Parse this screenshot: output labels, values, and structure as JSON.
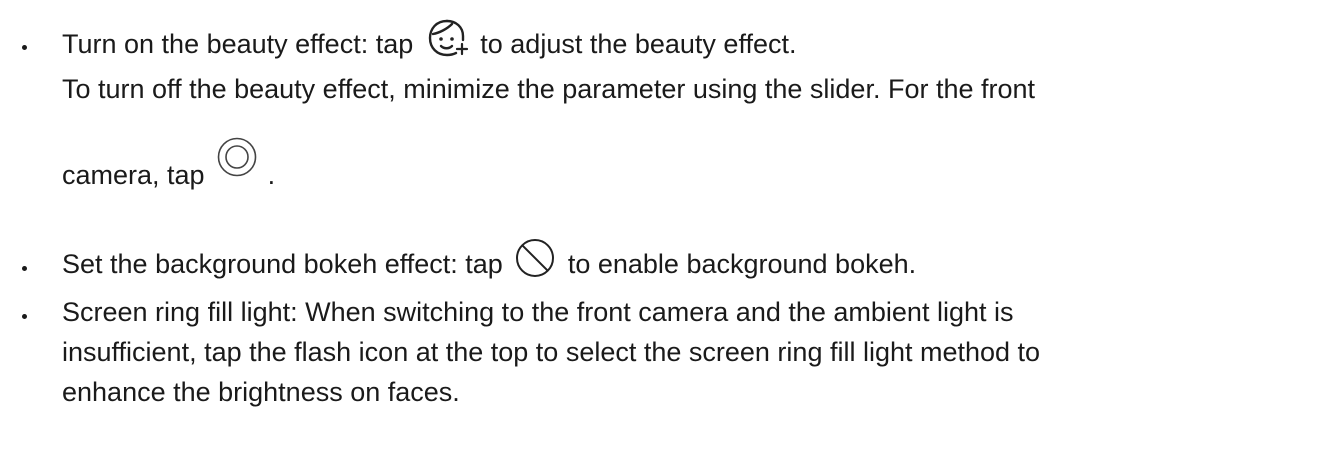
{
  "items": [
    {
      "lines": [
        {
          "before": "Turn on the beauty effect: tap ",
          "icon": "beauty-face-icon",
          "after": " to adjust the beauty effect."
        },
        {
          "text": "To turn off the beauty effect, minimize the parameter using the slider. For the front"
        },
        {
          "before": "camera, tap ",
          "icon": "circle-shutter-icon",
          "after": "."
        }
      ]
    },
    {
      "lines": [
        {
          "before": "Set the background bokeh effect: tap ",
          "icon": "bokeh-off-icon",
          "after": " to enable background bokeh."
        }
      ]
    },
    {
      "lines": [
        {
          "text": "Screen ring fill light: When switching to the front camera and the ambient light is"
        },
        {
          "text": "insufficient, tap the flash icon at the top to select the screen ring fill light method to"
        },
        {
          "text": "enhance the brightness on faces."
        }
      ]
    }
  ]
}
